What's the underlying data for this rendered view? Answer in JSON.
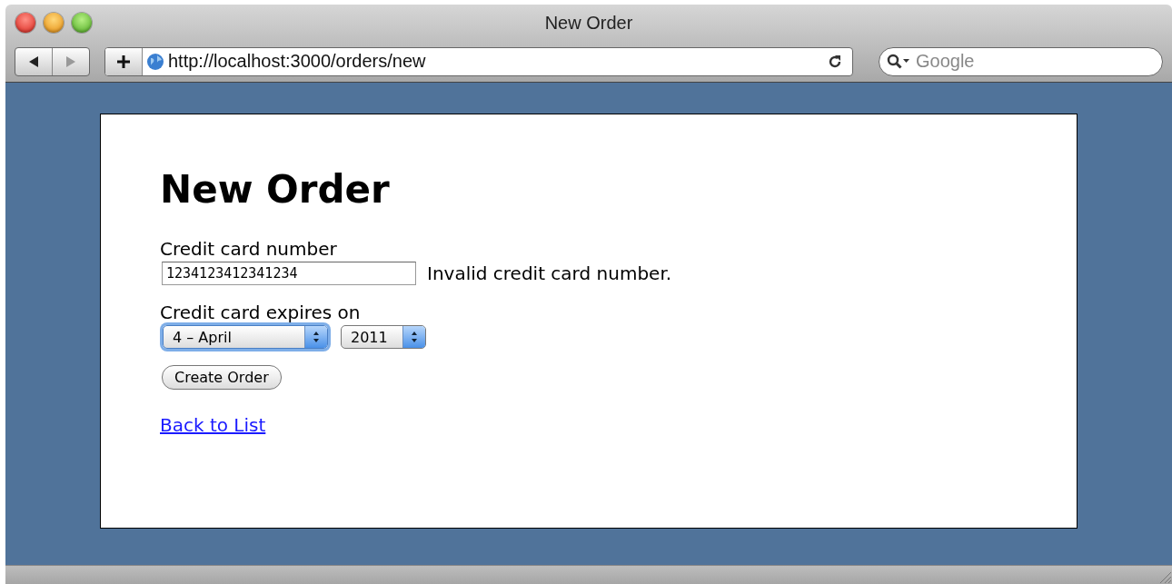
{
  "window": {
    "title": "New Order"
  },
  "toolbar": {
    "address": "http://localhost:3000/orders/new",
    "search": {
      "placeholder": "Google"
    }
  },
  "page": {
    "heading": "New Order",
    "fields": [
      {
        "kind": "text",
        "label": "Credit card number",
        "value": "1234123412341234",
        "error": "Invalid credit card number."
      },
      {
        "kind": "selects",
        "label": "Credit card expires on",
        "selects": [
          {
            "value": "4 – April",
            "focused": true
          },
          {
            "value": "2011",
            "focused": false
          }
        ]
      }
    ],
    "submit": "Create Order",
    "link": "Back to List"
  }
}
